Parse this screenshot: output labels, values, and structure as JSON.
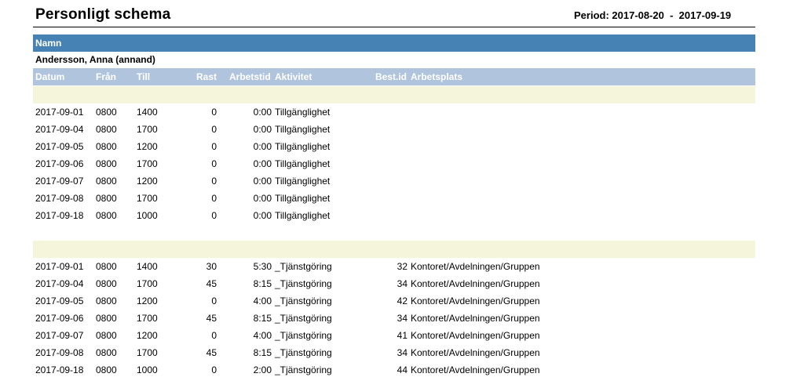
{
  "header": {
    "title": "Personligt schema",
    "period": "Period: 2017-08-20  -  2017-09-19"
  },
  "name_header": "Namn",
  "person": "Andersson, Anna (annand)",
  "columns": {
    "datum": "Datum",
    "fran": "Från",
    "till": "Till",
    "rast": "Rast",
    "arbetstid": "Arbetstid",
    "aktivitet": "Aktivitet",
    "bestid": "Best.id",
    "arbetsplats": "Arbetsplats"
  },
  "colors": {
    "name_band": "#4682b4",
    "column_band": "#b0c4de",
    "group_band": "#f5f5dc"
  },
  "groups": [
    {
      "rows": [
        {
          "datum": "2017-09-01",
          "fran": "0800",
          "till": "1400",
          "rast": "0",
          "arbetstid": "0:00",
          "aktivitet": "Tillgänglighet",
          "bestid": "",
          "arbetsplats": ""
        },
        {
          "datum": "2017-09-04",
          "fran": "0800",
          "till": "1700",
          "rast": "0",
          "arbetstid": "0:00",
          "aktivitet": "Tillgänglighet",
          "bestid": "",
          "arbetsplats": ""
        },
        {
          "datum": "2017-09-05",
          "fran": "0800",
          "till": "1200",
          "rast": "0",
          "arbetstid": "0:00",
          "aktivitet": "Tillgänglighet",
          "bestid": "",
          "arbetsplats": ""
        },
        {
          "datum": "2017-09-06",
          "fran": "0800",
          "till": "1700",
          "rast": "0",
          "arbetstid": "0:00",
          "aktivitet": "Tillgänglighet",
          "bestid": "",
          "arbetsplats": ""
        },
        {
          "datum": "2017-09-07",
          "fran": "0800",
          "till": "1200",
          "rast": "0",
          "arbetstid": "0:00",
          "aktivitet": "Tillgänglighet",
          "bestid": "",
          "arbetsplats": ""
        },
        {
          "datum": "2017-09-08",
          "fran": "0800",
          "till": "1700",
          "rast": "0",
          "arbetstid": "0:00",
          "aktivitet": "Tillgänglighet",
          "bestid": "",
          "arbetsplats": ""
        },
        {
          "datum": "2017-09-18",
          "fran": "0800",
          "till": "1000",
          "rast": "0",
          "arbetstid": "0:00",
          "aktivitet": "Tillgänglighet",
          "bestid": "",
          "arbetsplats": ""
        }
      ]
    },
    {
      "rows": [
        {
          "datum": "2017-09-01",
          "fran": "0800",
          "till": "1400",
          "rast": "30",
          "arbetstid": "5:30",
          "aktivitet": "_Tjänstgöring",
          "bestid": "32",
          "arbetsplats": "Kontoret/Avdelningen/Gruppen"
        },
        {
          "datum": "2017-09-04",
          "fran": "0800",
          "till": "1700",
          "rast": "45",
          "arbetstid": "8:15",
          "aktivitet": "_Tjänstgöring",
          "bestid": "34",
          "arbetsplats": "Kontoret/Avdelningen/Gruppen"
        },
        {
          "datum": "2017-09-05",
          "fran": "0800",
          "till": "1200",
          "rast": "0",
          "arbetstid": "4:00",
          "aktivitet": "_Tjänstgöring",
          "bestid": "42",
          "arbetsplats": "Kontoret/Avdelningen/Gruppen"
        },
        {
          "datum": "2017-09-06",
          "fran": "0800",
          "till": "1700",
          "rast": "45",
          "arbetstid": "8:15",
          "aktivitet": "_Tjänstgöring",
          "bestid": "34",
          "arbetsplats": "Kontoret/Avdelningen/Gruppen"
        },
        {
          "datum": "2017-09-07",
          "fran": "0800",
          "till": "1200",
          "rast": "0",
          "arbetstid": "4:00",
          "aktivitet": "_Tjänstgöring",
          "bestid": "41",
          "arbetsplats": "Kontoret/Avdelningen/Gruppen"
        },
        {
          "datum": "2017-09-08",
          "fran": "0800",
          "till": "1700",
          "rast": "45",
          "arbetstid": "8:15",
          "aktivitet": "_Tjänstgöring",
          "bestid": "34",
          "arbetsplats": "Kontoret/Avdelningen/Gruppen"
        },
        {
          "datum": "2017-09-18",
          "fran": "0800",
          "till": "1000",
          "rast": "0",
          "arbetstid": "2:00",
          "aktivitet": "_Tjänstgöring",
          "bestid": "44",
          "arbetsplats": "Kontoret/Avdelningen/Gruppen"
        }
      ]
    }
  ]
}
